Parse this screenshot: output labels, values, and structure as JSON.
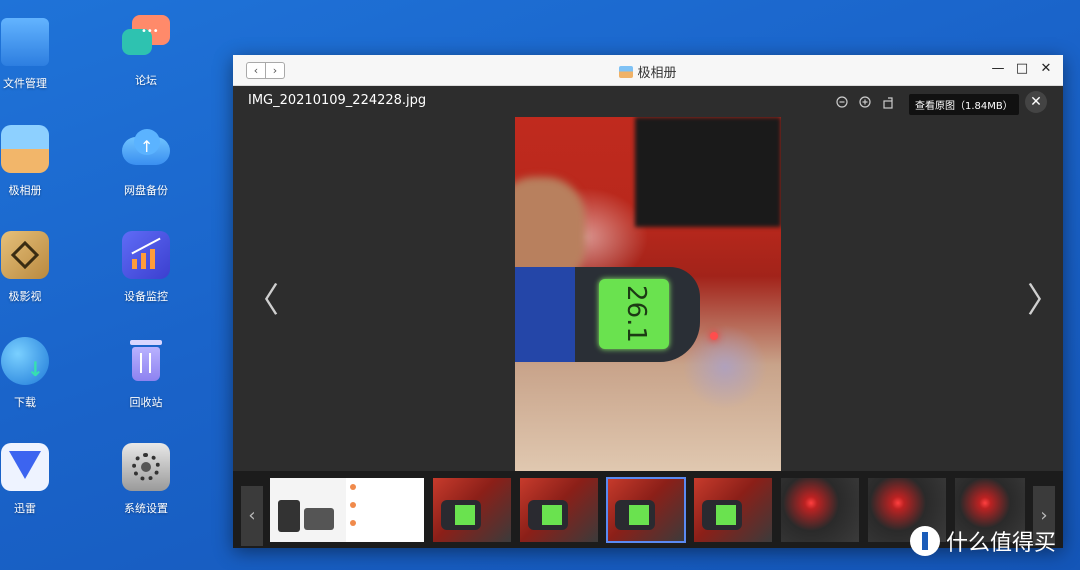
{
  "desktop": {
    "icons": [
      {
        "label": "文件管理",
        "icon": "folder-icon"
      },
      {
        "label": "论坛",
        "icon": "chat-bubbles-icon"
      },
      {
        "label": "极相册",
        "icon": "photo-album-icon"
      },
      {
        "label": "网盘备份",
        "icon": "cloud-upload-icon"
      },
      {
        "label": "极影视",
        "icon": "video-icon"
      },
      {
        "label": "设备监控",
        "icon": "chart-monitor-icon"
      },
      {
        "label": "下载",
        "icon": "download-globe-icon"
      },
      {
        "label": "回收站",
        "icon": "trash-icon"
      },
      {
        "label": "迅雷",
        "icon": "thunder-bird-icon"
      },
      {
        "label": "系统设置",
        "icon": "gear-icon"
      }
    ]
  },
  "window": {
    "title": "极相册",
    "controls": {
      "minimize": "—",
      "maximize": "□",
      "close": "✕"
    }
  },
  "viewer": {
    "filename": "IMG_20210109_224228.jpg",
    "original_button": "查看原图（1.84MB）",
    "close": "✕",
    "prev": "〈",
    "next": "〉",
    "thermometer_reading": "26.1"
  },
  "strip": {
    "prev": "‹",
    "next": "›",
    "thumbnails": [
      "screenshot-phone",
      "screenshot-chat",
      "thermometer-24.1",
      "thermometer-24.1",
      "thermometer-selected",
      "thermometer-24.1",
      "red-light",
      "red-light",
      "red-light"
    ]
  },
  "watermark": {
    "text": "什么值得买"
  },
  "colors": {
    "desktop_bg": "#1a63c9",
    "accent": "#5b8af2",
    "lcd": "#6ae24f"
  }
}
